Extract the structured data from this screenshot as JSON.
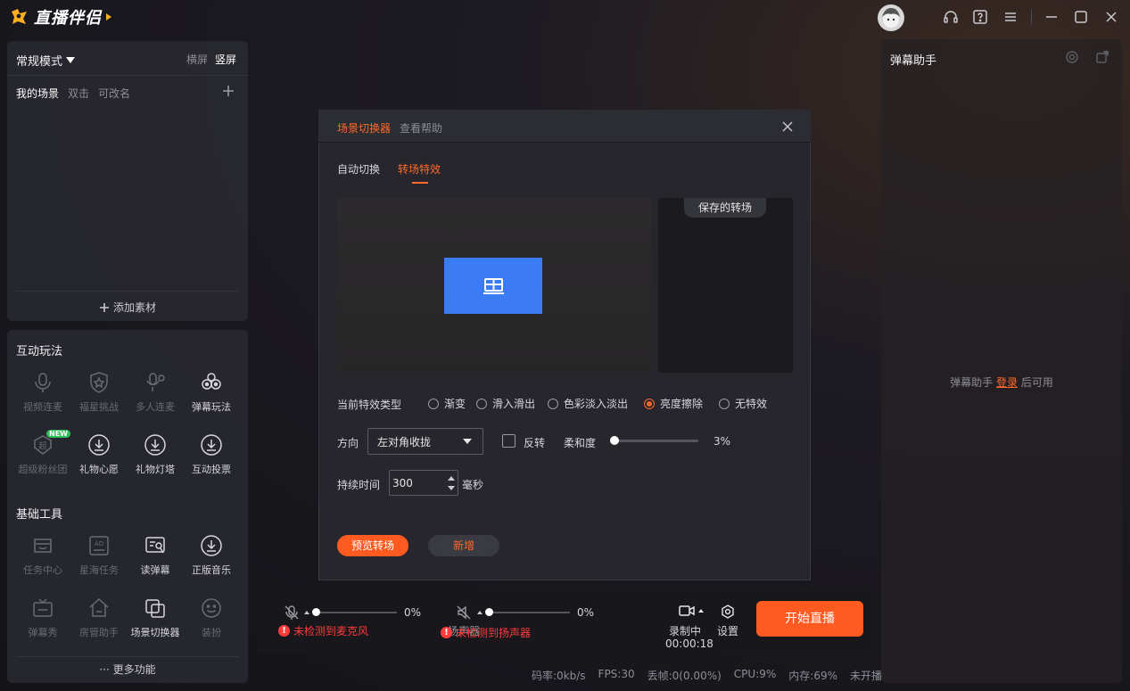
{
  "app": {
    "name": "直播伴侣"
  },
  "scenes": {
    "mode": "常规模式",
    "orient_landscape": "横屏",
    "orient_portrait": "竖屏",
    "my_scene": "我的场景",
    "dblclick": "双击",
    "renamable": "可改名",
    "add_material": "添加素材"
  },
  "interactive": {
    "title": "互动玩法",
    "items": [
      {
        "label": "视频连麦",
        "icon": "mic-icon",
        "enabled": false
      },
      {
        "label": "福星挑战",
        "icon": "shield-star-icon",
        "enabled": false
      },
      {
        "label": "多人连麦",
        "icon": "multi-mic-icon",
        "enabled": false
      },
      {
        "label": "弹幕玩法",
        "icon": "danmu-play-icon",
        "enabled": true
      },
      {
        "label": "超级粉丝团",
        "icon": "fan-club-icon",
        "enabled": false,
        "badge": "NEW"
      },
      {
        "label": "礼物心愿",
        "icon": "download-icon",
        "enabled": true
      },
      {
        "label": "礼物灯塔",
        "icon": "download-icon",
        "enabled": true
      },
      {
        "label": "互动投票",
        "icon": "download-icon",
        "enabled": true
      }
    ]
  },
  "basic": {
    "title": "基础工具",
    "items": [
      {
        "label": "任务中心",
        "icon": "task-icon",
        "enabled": false
      },
      {
        "label": "星海任务",
        "icon": "ad-icon",
        "enabled": false
      },
      {
        "label": "读弹幕",
        "icon": "read-danmu-icon",
        "enabled": true
      },
      {
        "label": "正版音乐",
        "icon": "download-icon",
        "enabled": true
      },
      {
        "label": "弹幕秀",
        "icon": "tv-icon",
        "enabled": false
      },
      {
        "label": "房管助手",
        "icon": "home-icon",
        "enabled": false
      },
      {
        "label": "场景切换器",
        "icon": "scene-switch-icon",
        "enabled": true
      },
      {
        "label": "装扮",
        "icon": "smile-icon",
        "enabled": false
      }
    ],
    "more": "更多功能"
  },
  "danmu": {
    "title": "弹幕助手",
    "msg_prefix": "弹幕助手",
    "login": "登录",
    "msg_suffix": "后可用"
  },
  "modal": {
    "title": "场景切换器",
    "help": "查看帮助",
    "tab_auto": "自动切换",
    "tab_transition": "转场特效",
    "saved": "保存的转场",
    "fx_label": "当前特效类型",
    "fx_options": [
      "渐变",
      "滑入滑出",
      "色彩淡入淡出",
      "亮度擦除",
      "无特效"
    ],
    "fx_selected": "亮度擦除",
    "dir_label": "方向",
    "dir_value": "左对角收拢",
    "reverse": "反转",
    "soft_label": "柔和度",
    "soft_value": "3%",
    "soft_fraction": 0.03,
    "dur_label": "持续时间",
    "dur_value": "300",
    "dur_unit": "毫秒",
    "btn_preview": "预览转场",
    "btn_new": "新增"
  },
  "bottom": {
    "mic_pct": "0%",
    "mic_warn": "未检测到麦克风",
    "spk_label": "扬声器",
    "spk_pct": "0%",
    "spk_warn": "未检测到扬声器",
    "rec_label": "录制中",
    "rec_time": "00:00:18",
    "settings": "设置",
    "go_live": "开始直播"
  },
  "status": {
    "bitrate": "码率:0kb/s",
    "fps": "FPS:30",
    "drop": "丢帧:0(0.00%)",
    "cpu": "CPU:9%",
    "mem": "内存:69%",
    "live": "未开播"
  },
  "colors": {
    "accent": "#ff5a1f",
    "preview_box": "#3b7cf6",
    "warn": "#ff3b3b"
  }
}
